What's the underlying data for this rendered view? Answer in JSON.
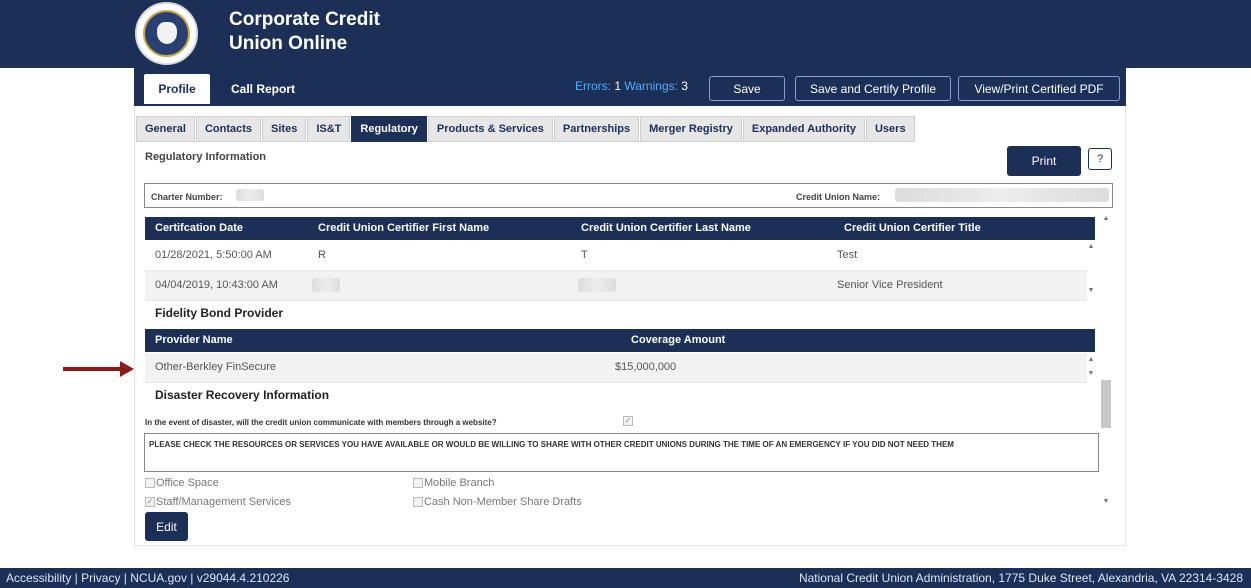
{
  "app": {
    "title_line1": "Corporate Credit",
    "title_line2": "Union Online"
  },
  "top_tabs": {
    "profile": "Profile",
    "call_report": "Call Report"
  },
  "status": {
    "errors_label": "Errors:",
    "errors_count": "1",
    "warnings_label": "Warnings:",
    "warnings_count": "3"
  },
  "top_buttons": {
    "save": "Save",
    "save_certify": "Save and Certify Profile",
    "view_print": "View/Print Certified PDF"
  },
  "sub_tabs": [
    "General",
    "Contacts",
    "Sites",
    "IS&T",
    "Regulatory",
    "Products & Services",
    "Partnerships",
    "Merger Registry",
    "Expanded Authority",
    "Users"
  ],
  "active_sub_tab": "Regulatory",
  "regulatory": {
    "section_title": "Regulatory Information",
    "print": "Print",
    "help": "?",
    "charter_label": "Charter Number:",
    "cu_name_label": "Credit Union Name:",
    "cert_table": {
      "headers": [
        "Certifcation Date",
        "Credit Union Certifier First Name",
        "Credit Union Certifier Last Name",
        "Credit Union Certifier Title"
      ],
      "rows": [
        [
          "01/28/2021, 5:50:00 AM",
          "R",
          "T",
          "Test"
        ],
        [
          "04/04/2019, 10:43:00 AM",
          "",
          "",
          "Senior Vice President"
        ]
      ]
    },
    "fidelity_title": "Fidelity Bond Provider",
    "fidelity_table": {
      "headers": [
        "Provider Name",
        "Coverage Amount"
      ],
      "rows": [
        [
          "Other-Berkley FinSecure",
          "$15,000,000"
        ]
      ]
    },
    "disaster_title": "Disaster Recovery Information",
    "disaster_question": "In the event of disaster, will the credit union communicate with members through a website?",
    "resources_notice": "PLEASE CHECK THE RESOURCES OR SERVICES YOU HAVE AVAILABLE OR WOULD BE WILLING TO SHARE WITH OTHER CREDIT UNIONS DURING THE TIME OF AN EMERGENCY IF YOU DID NOT NEED THEM",
    "options": {
      "office_space": "Office Space",
      "mobile_branch": "Mobile Branch",
      "staff_mgmt": "Staff/Management Services",
      "cash_non_member": "Cash Non-Member Share Drafts"
    },
    "edit": "Edit"
  },
  "footer": {
    "left": "Accessibility | Privacy | NCUA.gov | v29044.4.210226",
    "right": "National Credit Union Administration, 1775 Duke Street, Alexandria, VA 22314-3428"
  },
  "colors": {
    "navy": "#1b2f57",
    "arrow": "#8b1a1a",
    "link_blue": "#4fb0ff"
  }
}
